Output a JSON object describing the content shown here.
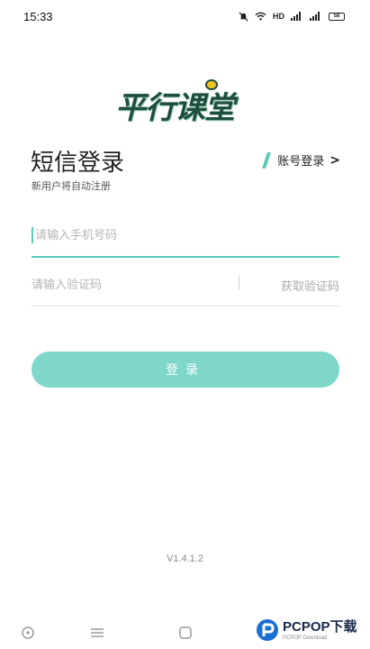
{
  "status_bar": {
    "time": "15:33",
    "hd_label": "HD",
    "battery": "58"
  },
  "brand": {
    "logo_text": "平行课堂",
    "primary_color": "#1f4e3d",
    "accent_color": "#5ccab7"
  },
  "login": {
    "title": "短信登录",
    "subtitle": "新用户将自动注册",
    "account_login_label": "账号登录",
    "account_login_arrow": ">",
    "phone_placeholder": "请输入手机号码",
    "code_placeholder": "请输入验证码",
    "get_code_label": "获取验证码",
    "submit_label": "登录"
  },
  "footer": {
    "version": "V1.4.1.2"
  },
  "nav_bar": {
    "icons": [
      "back-icon",
      "menu-icon",
      "home-icon"
    ]
  },
  "watermark": {
    "main": "PCPOP下载",
    "sub": "PCPOP Download"
  }
}
